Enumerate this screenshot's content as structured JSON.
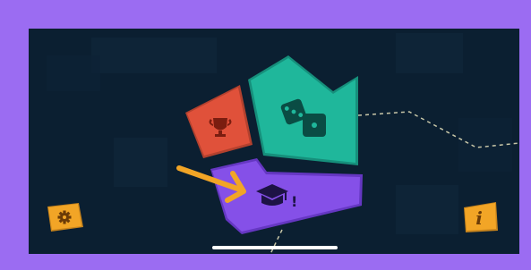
{
  "screen": {
    "background_color": "#0b1f31",
    "frame_color": "#9b6cf2"
  },
  "tiles": [
    {
      "name": "trophy",
      "icon": "trophy-icon",
      "color": "#e0513a",
      "icon_color": "#7a1d10"
    },
    {
      "name": "dice",
      "icon": "dice-icon",
      "color": "#1fb79b",
      "icon_color": "#0a4c44"
    },
    {
      "name": "learn",
      "icon": "graduation-cap-icon",
      "color": "#8550e8",
      "icon_color": "#1d1345",
      "badge": "!"
    }
  ],
  "corner_buttons": {
    "settings": {
      "icon": "gear-icon",
      "color": "#f2a526"
    },
    "info": {
      "icon": "info-icon",
      "color": "#f2a526",
      "glyph": "i"
    }
  },
  "tutorial_arrow": {
    "icon": "arrow-icon",
    "color": "#f2a526"
  }
}
